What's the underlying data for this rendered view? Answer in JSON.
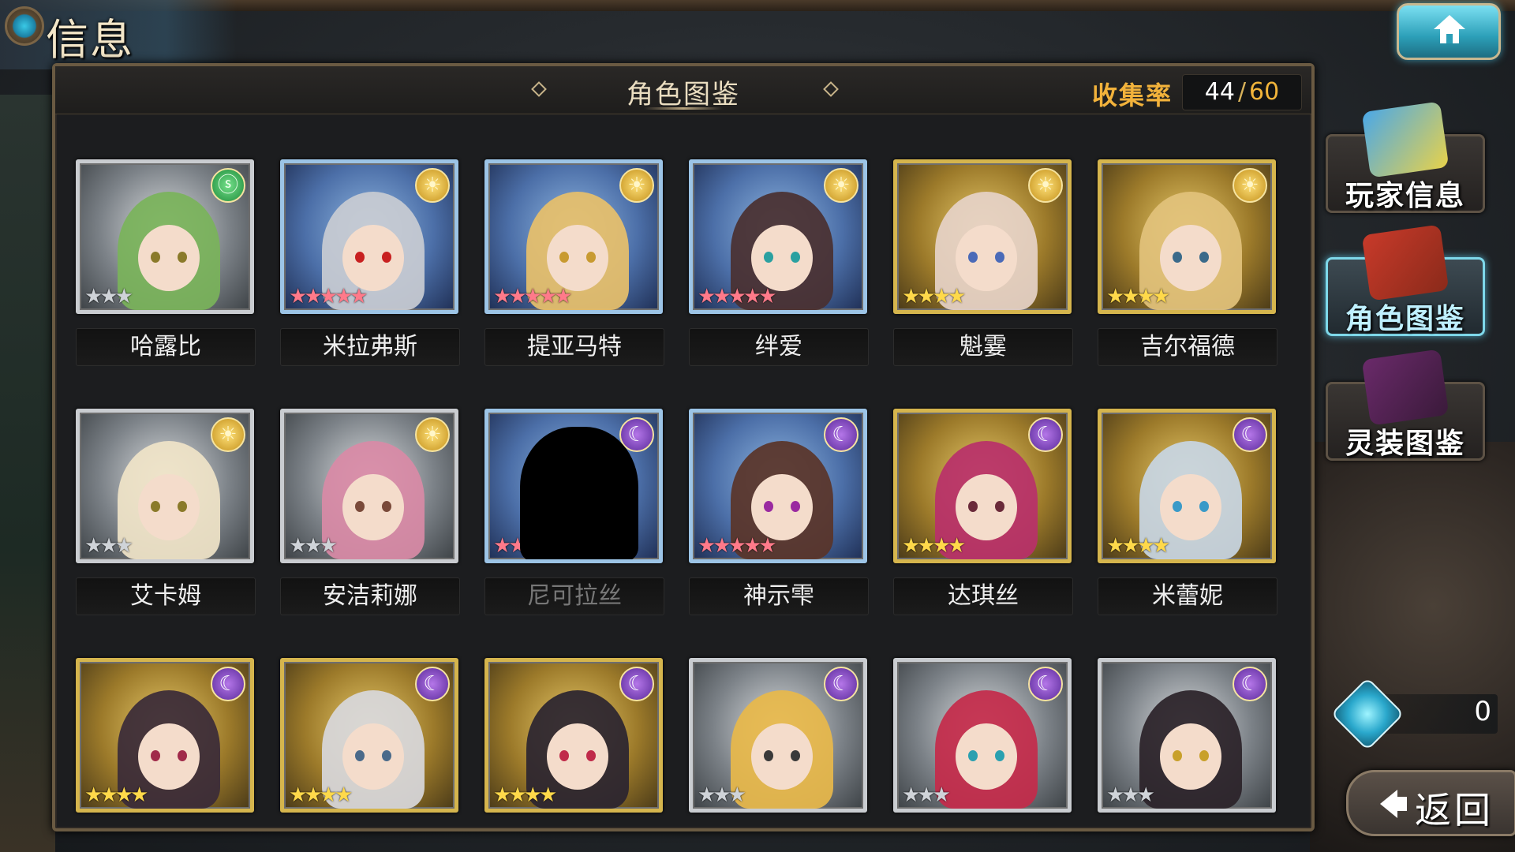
{
  "header": {
    "title": "信息"
  },
  "panel": {
    "title": "角色图鉴",
    "collection_label": "收集率",
    "collected": "44",
    "separator": "/",
    "total": "60"
  },
  "cards": [
    {
      "name": "哈露比",
      "element": "wind-icon",
      "element_glyph": "ⓢ",
      "rarity": 3,
      "frame": "silver",
      "locked": false
    },
    {
      "name": "米拉弗斯",
      "element": "sun-icon",
      "element_glyph": "☀",
      "rarity": 5,
      "frame": "blue",
      "locked": false
    },
    {
      "name": "提亚马特",
      "element": "sun-icon",
      "element_glyph": "☀",
      "rarity": 5,
      "frame": "blue",
      "locked": false
    },
    {
      "name": "绊爱",
      "element": "sun-icon",
      "element_glyph": "☀",
      "rarity": 5,
      "frame": "blue",
      "locked": false
    },
    {
      "name": "魁霎",
      "element": "sun-icon",
      "element_glyph": "☀",
      "rarity": 4,
      "frame": "gold",
      "locked": false
    },
    {
      "name": "吉尔福德",
      "element": "sun-icon",
      "element_glyph": "☀",
      "rarity": 4,
      "frame": "gold",
      "locked": false
    },
    {
      "name": "艾卡姆",
      "element": "sun-icon",
      "element_glyph": "☀",
      "rarity": 3,
      "frame": "silver",
      "locked": false
    },
    {
      "name": "安洁莉娜",
      "element": "sun-icon",
      "element_glyph": "☀",
      "rarity": 3,
      "frame": "silver",
      "locked": false
    },
    {
      "name": "尼可拉丝",
      "element": "moon-icon",
      "element_glyph": "☾",
      "rarity": 5,
      "frame": "blue",
      "locked": true
    },
    {
      "name": "神示雫",
      "element": "moon-icon",
      "element_glyph": "☾",
      "rarity": 5,
      "frame": "blue",
      "locked": false
    },
    {
      "name": "达琪丝",
      "element": "moon-icon",
      "element_glyph": "☾",
      "rarity": 4,
      "frame": "gold",
      "locked": false
    },
    {
      "name": "米蕾妮",
      "element": "moon-icon",
      "element_glyph": "☾",
      "rarity": 4,
      "frame": "gold",
      "locked": false
    },
    {
      "name": "",
      "element": "moon-icon",
      "element_glyph": "☾",
      "rarity": 4,
      "frame": "gold",
      "locked": false
    },
    {
      "name": "",
      "element": "moon-icon",
      "element_glyph": "☾",
      "rarity": 4,
      "frame": "gold",
      "locked": false
    },
    {
      "name": "",
      "element": "moon-icon",
      "element_glyph": "☾",
      "rarity": 4,
      "frame": "gold",
      "locked": false
    },
    {
      "name": "",
      "element": "moon-icon",
      "element_glyph": "☾",
      "rarity": 3,
      "frame": "silver",
      "locked": false
    },
    {
      "name": "",
      "element": "moon-icon",
      "element_glyph": "☾",
      "rarity": 3,
      "frame": "silver",
      "locked": false
    },
    {
      "name": "",
      "element": "moon-icon",
      "element_glyph": "☾",
      "rarity": 3,
      "frame": "silver",
      "locked": false
    }
  ],
  "side_menu": [
    {
      "label": "玩家信息",
      "active": false
    },
    {
      "label": "角色图鉴",
      "active": true
    },
    {
      "label": "灵装图鉴",
      "active": false
    }
  ],
  "currency": {
    "value": "0",
    "icon": "gem-icon"
  },
  "back_button": {
    "label": "返回"
  },
  "colors": {
    "accent": "#f2b23b",
    "active": "#7ed8ea",
    "star_gold": "#ffd94a",
    "star_pink": "#ff7a8a"
  }
}
